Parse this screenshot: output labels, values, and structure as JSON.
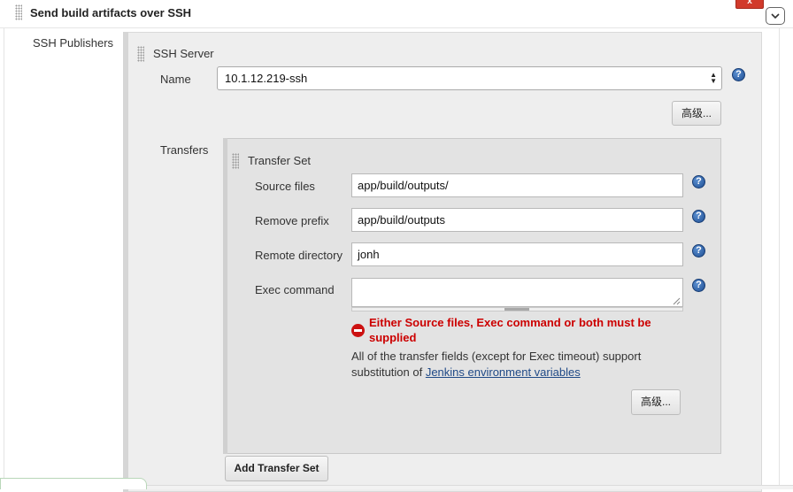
{
  "section": {
    "title": "Send build artifacts over SSH",
    "close_label": "x"
  },
  "publishers": {
    "label": "SSH Publishers"
  },
  "ssh_server": {
    "title": "SSH Server",
    "name_label": "Name",
    "name_value": "10.1.12.219-ssh",
    "advanced_label": "高级..."
  },
  "transfers": {
    "label": "Transfers",
    "set_title": "Transfer Set",
    "fields": {
      "source_label": "Source files",
      "source_value": "app/build/outputs/",
      "remove_prefix_label": "Remove prefix",
      "remove_prefix_value": "app/build/outputs",
      "remote_dir_label": "Remote directory",
      "remote_dir_value": "jonh",
      "exec_label": "Exec command",
      "exec_value": ""
    },
    "error_line1": "Either Source files, Exec command or both must be",
    "error_line2": "supplied",
    "info_line1": "All of the transfer fields (except for Exec timeout) support",
    "info_line2_prefix": "substitution of ",
    "info_link": "Jenkins environment variables",
    "advanced_label": "高级...",
    "add_button_label": "Add Transfer Set"
  },
  "icons": {
    "help": "help-icon",
    "error": "error-icon",
    "grip": "drag-handle-icon",
    "collapse": "chevron-down-icon"
  },
  "colors": {
    "error": "#cc0000",
    "link": "#204a87",
    "close": "#d13a2b",
    "help": "#1f4f94"
  }
}
